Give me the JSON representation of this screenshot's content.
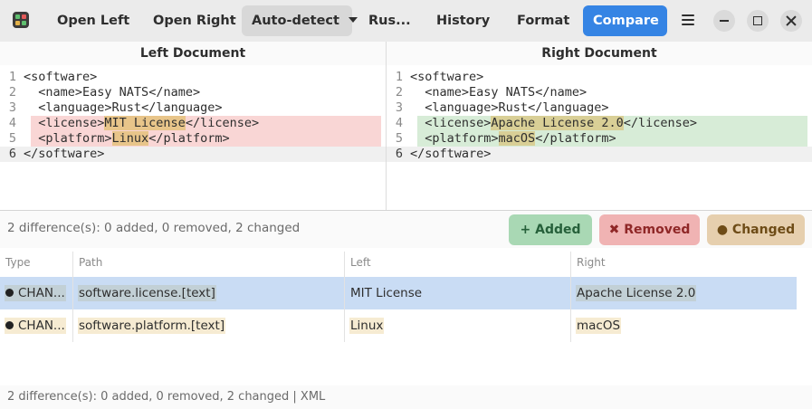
{
  "toolbar": {
    "open_left": "Open Left",
    "open_right": "Open Right",
    "format_select": "Auto-detect",
    "language": "Rus...",
    "history": "History",
    "format": "Format",
    "compare": "Compare"
  },
  "left_pane": {
    "title": "Left Document",
    "lines": [
      {
        "num": "1",
        "text": "<software>"
      },
      {
        "num": "2",
        "pre": "  <name>",
        "mid": "Easy NATS",
        "post": "</name>"
      },
      {
        "num": "3",
        "pre": "  <language>",
        "mid": "Rust",
        "post": "</language>"
      },
      {
        "num": "4",
        "pre": "  <license>",
        "mid": "MIT License",
        "post": "</license>"
      },
      {
        "num": "5",
        "pre": "  <platform>",
        "mid": "Linux",
        "post": "</platform>"
      },
      {
        "num": "6",
        "text": "</software>"
      }
    ]
  },
  "right_pane": {
    "title": "Right Document",
    "lines": [
      {
        "num": "1",
        "text": "<software>"
      },
      {
        "num": "2",
        "pre": "  <name>",
        "mid": "Easy NATS",
        "post": "</name>"
      },
      {
        "num": "3",
        "pre": "  <language>",
        "mid": "Rust",
        "post": "</language>"
      },
      {
        "num": "4",
        "pre": "  <license>",
        "mid": "Apache License 2.0",
        "post": "</license>"
      },
      {
        "num": "5",
        "pre": "  <platform>",
        "mid": "macOS",
        "post": "</platform>"
      },
      {
        "num": "6",
        "text": "</software>"
      }
    ]
  },
  "summary": "2 difference(s): 0 added, 0 removed, 2 changed",
  "filters": {
    "added": "+ Added",
    "removed": "✖ Removed",
    "changed": "● Changed"
  },
  "table": {
    "headers": {
      "type": "Type",
      "path": "Path",
      "left": "Left",
      "right": "Right"
    },
    "rows": [
      {
        "type": "CHAN...",
        "path": "software.license.[text]",
        "left": "MIT License",
        "right": "Apache License 2.0"
      },
      {
        "type": "CHAN...",
        "path": "software.platform.[text]",
        "left": "Linux",
        "right": "macOS"
      }
    ]
  },
  "status": "2 difference(s): 0 added, 0 removed, 2 changed | XML",
  "colors": {
    "accent": "#3584e4",
    "removed_band": "#f9d6d5",
    "added_band": "#d7ecd7",
    "change_highlight": "#e8c58a",
    "selected_row": "#c9dcf4"
  }
}
